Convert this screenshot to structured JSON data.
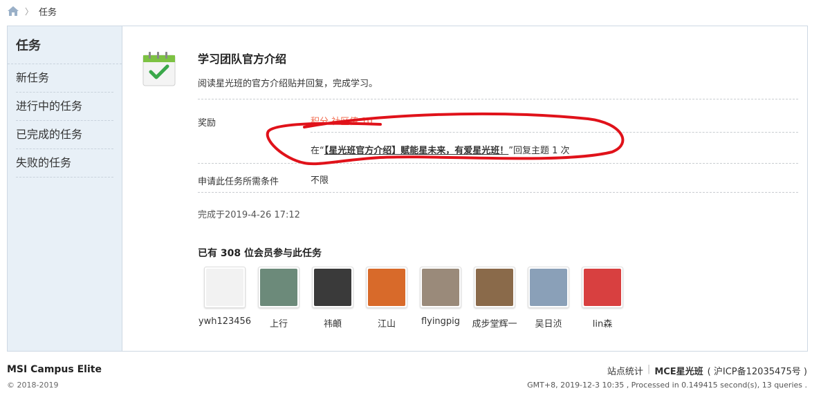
{
  "breadcrumb": {
    "current": "任务"
  },
  "sidebar": {
    "title": "任务",
    "items": [
      {
        "label": "新任务"
      },
      {
        "label": "进行中的任务"
      },
      {
        "label": "已完成的任务"
      },
      {
        "label": "失败的任务"
      }
    ]
  },
  "task": {
    "title": "学习团队官方介绍",
    "description": "阅读星光班的官方介绍贴并回复，完成学习。",
    "reward_label": "奖励",
    "reward_value": "积分 社区值 10",
    "requirement_prefix": "在“",
    "requirement_link": "【星光班官方介绍】赋能星未来，有爱星光班！",
    "requirement_suffix": "”回复主题 1 次",
    "condition_label": "申请此任务所需条件",
    "condition_value": "不限",
    "completed_at": "完成于2019-4-26 17:12"
  },
  "members": {
    "title": "已有 308 位会员参与此任务",
    "list": [
      {
        "name": "ywh123456",
        "color": "#f2f2f2"
      },
      {
        "name": "上行",
        "color": "#6c8a7a"
      },
      {
        "name": "祎頔",
        "color": "#3a3a3a"
      },
      {
        "name": "江山",
        "color": "#d86a2a"
      },
      {
        "name": "flyingpig",
        "color": "#9a8a7a"
      },
      {
        "name": "成步堂辉一",
        "color": "#8a6a4a"
      },
      {
        "name": "吴日浈",
        "color": "#8aa0b8"
      },
      {
        "name": "lin森",
        "color": "#d84040"
      }
    ]
  },
  "footer": {
    "site_name": "MSI Campus Elite",
    "copyright": "© 2018-2019",
    "stats_link": "站点统计",
    "brand_link": "MCE星光班",
    "icp": "( 沪ICP备12035475号 )",
    "info": "GMT+8, 2019-12-3 10:35 , Processed in 0.149415 second(s), 13 queries ."
  },
  "colors": {
    "accent": "#f26c4f",
    "sidebar_bg": "#e8f0f7",
    "scribble": "#e0121a"
  }
}
